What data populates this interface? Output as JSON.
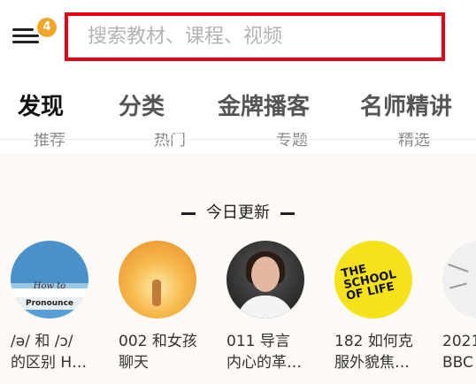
{
  "header": {
    "menu_badge": "4",
    "search_placeholder": "搜索教材、课程、视频"
  },
  "tabs": [
    {
      "label": "发现",
      "active": true
    },
    {
      "label": "分类",
      "active": false
    },
    {
      "label": "金牌播客",
      "active": false
    },
    {
      "label": "名师精讲",
      "active": false
    }
  ],
  "subtabs": [
    {
      "label": "推荐"
    },
    {
      "label": "热门"
    },
    {
      "label": "专题"
    },
    {
      "label": "精选"
    }
  ],
  "section": {
    "title": "今日更新"
  },
  "cards": [
    {
      "line1": "/ə/ 和 /ɔ/",
      "line2": "的区别 H…",
      "cover_text_1": "How to",
      "cover_text_2": "Pronounce"
    },
    {
      "line1": "002 和女孩",
      "line2": "聊天"
    },
    {
      "line1": "011 导言",
      "line2": "内心的革…"
    },
    {
      "line1": "182 如何克",
      "line2": "服外貌焦…",
      "cover_text": "THE SCHOOL OF LIFE"
    },
    {
      "line1": "2021",
      "line2": "BBC"
    }
  ],
  "colors": {
    "search_border": "#e60012",
    "badge": "#f2a52b",
    "content_bg": "#fdf9f4"
  }
}
